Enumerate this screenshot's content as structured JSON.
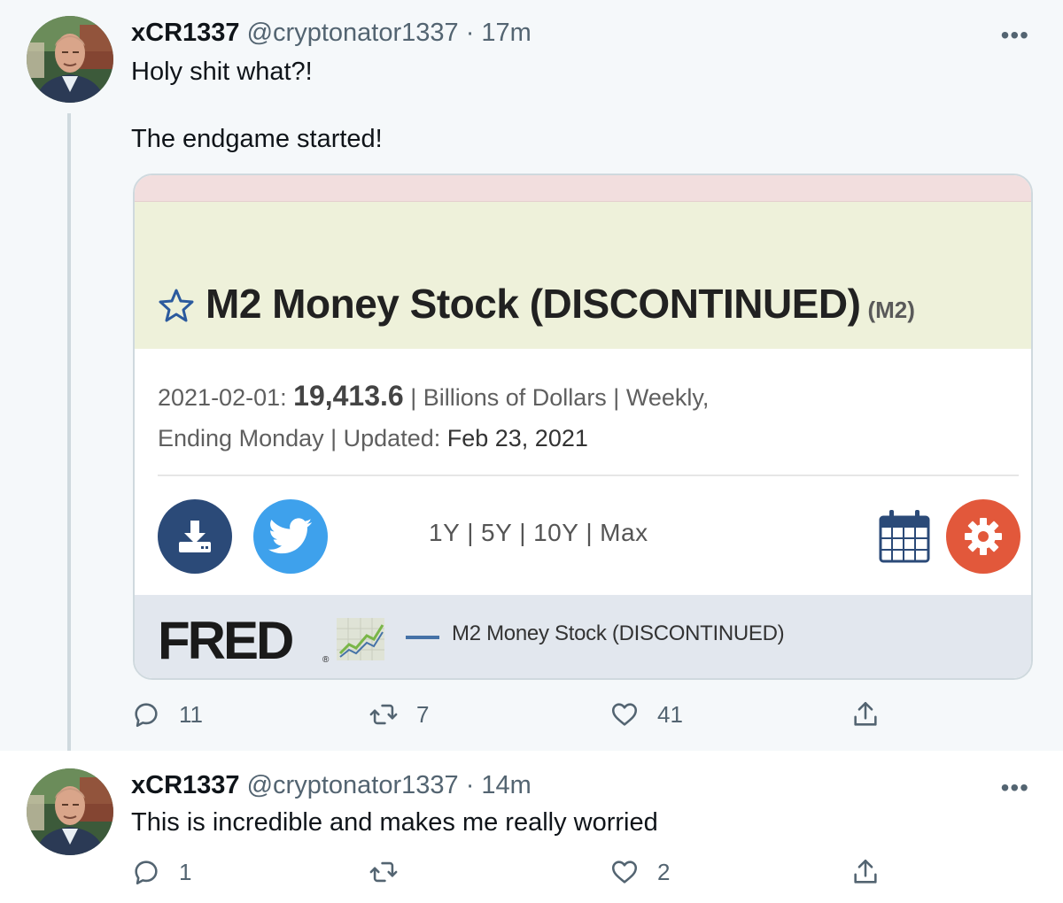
{
  "tweets": [
    {
      "name": "xCR1337",
      "handle": "@cryptonator1337",
      "separator": "·",
      "time": "17m",
      "more_label": "•••",
      "text_line1": "Holy shit what?!",
      "text_line2": "The endgame started!",
      "card": {
        "title": "M2 Money Stock (DISCONTINUED)",
        "code": "(M2)",
        "date_label": "2021-02-01:",
        "value": "19,413.6",
        "info_rest_line1": "| Billions of Dollars | Weekly,",
        "info_line2_a": "Ending Monday | Updated:",
        "info_line2_b": "Feb 23, 2021",
        "ranges": [
          "1Y",
          "5Y",
          "10Y",
          "Max"
        ],
        "range_sep": "|",
        "brand": "FRED",
        "brand_reg": "®",
        "legend": "M2 Money Stock (DISCONTINUED)"
      },
      "actions": {
        "reply": "11",
        "retweet": "7",
        "like": "41"
      }
    },
    {
      "name": "xCR1337",
      "handle": "@cryptonator1337",
      "separator": "·",
      "time": "14m",
      "more_label": "•••",
      "text_line1": "This is incredible and makes me really worried",
      "actions": {
        "reply": "1",
        "retweet": "",
        "like": "2"
      }
    }
  ],
  "icons": [
    "reply-icon",
    "retweet-icon",
    "like-icon",
    "share-icon",
    "star-icon",
    "download-icon",
    "twitter-icon",
    "calendar-icon",
    "gear-icon"
  ],
  "colors": {
    "accent_blue": "#3ea1ec",
    "download_navy": "#2b4a78",
    "settings_orange": "#e2583b",
    "card_yellow": "#eef1da",
    "card_pink": "#f2dede",
    "muted": "#536471"
  }
}
